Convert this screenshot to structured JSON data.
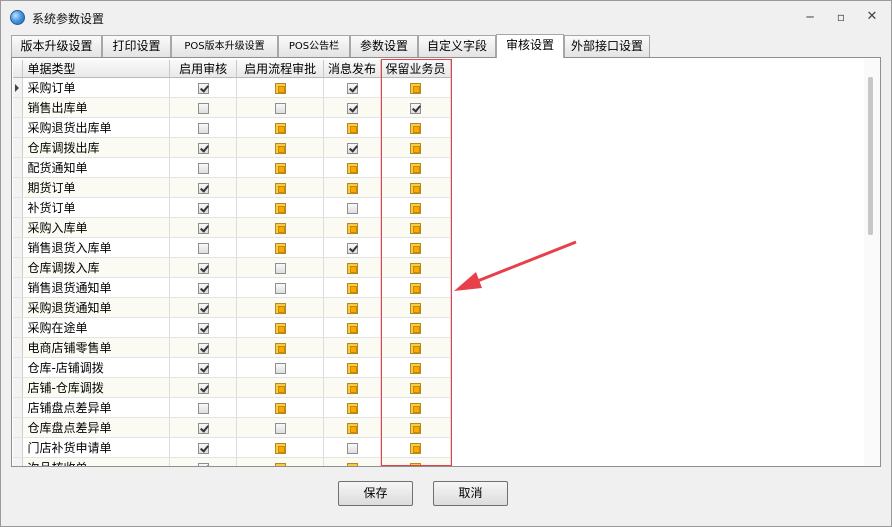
{
  "window": {
    "title": "系统参数设置",
    "minimize_label": "─",
    "maximize_label": "▫",
    "close_label": "✕"
  },
  "tabs": [
    {
      "label": "版本升级设置"
    },
    {
      "label": "打印设置"
    },
    {
      "label": "POS版本升级设置"
    },
    {
      "label": "POS公告栏"
    },
    {
      "label": "参数设置"
    },
    {
      "label": "自定义字段"
    },
    {
      "label": "审核设置"
    },
    {
      "label": "外部接口设置"
    }
  ],
  "active_tab": "审核设置",
  "grid": {
    "columns": [
      "单据类型",
      "启用审核",
      "启用流程审批",
      "消息发布",
      "保留业务员"
    ],
    "rows": [
      {
        "name": "采购订单",
        "review": "checked",
        "workflow": "indeterminate",
        "message": "checked",
        "salesman": "indeterminate"
      },
      {
        "name": "销售出库单",
        "review": "unchecked",
        "workflow": "unchecked",
        "message": "checked",
        "salesman": "checked"
      },
      {
        "name": "采购退货出库单",
        "review": "unchecked",
        "workflow": "indeterminate",
        "message": "indeterminate",
        "salesman": "indeterminate"
      },
      {
        "name": "仓库调拨出库",
        "review": "checked",
        "workflow": "indeterminate",
        "message": "checked",
        "salesman": "indeterminate"
      },
      {
        "name": "配货通知单",
        "review": "unchecked",
        "workflow": "indeterminate",
        "message": "indeterminate",
        "salesman": "indeterminate"
      },
      {
        "name": "期货订单",
        "review": "checked",
        "workflow": "indeterminate",
        "message": "indeterminate",
        "salesman": "indeterminate"
      },
      {
        "name": "补货订单",
        "review": "checked",
        "workflow": "indeterminate",
        "message": "unchecked",
        "salesman": "indeterminate"
      },
      {
        "name": "采购入库单",
        "review": "checked",
        "workflow": "indeterminate",
        "message": "indeterminate",
        "salesman": "indeterminate"
      },
      {
        "name": "销售退货入库单",
        "review": "unchecked",
        "workflow": "indeterminate",
        "message": "checked",
        "salesman": "indeterminate"
      },
      {
        "name": "仓库调拨入库",
        "review": "checked",
        "workflow": "unchecked",
        "message": "indeterminate",
        "salesman": "indeterminate"
      },
      {
        "name": "销售退货通知单",
        "review": "checked",
        "workflow": "unchecked",
        "message": "indeterminate",
        "salesman": "indeterminate"
      },
      {
        "name": "采购退货通知单",
        "review": "checked",
        "workflow": "indeterminate",
        "message": "indeterminate",
        "salesman": "indeterminate"
      },
      {
        "name": "采购在途单",
        "review": "checked",
        "workflow": "indeterminate",
        "message": "indeterminate",
        "salesman": "indeterminate"
      },
      {
        "name": "电商店铺零售单",
        "review": "checked",
        "workflow": "indeterminate",
        "message": "indeterminate",
        "salesman": "indeterminate"
      },
      {
        "name": "仓库-店铺调拨",
        "review": "checked",
        "workflow": "unchecked",
        "message": "indeterminate",
        "salesman": "indeterminate"
      },
      {
        "name": "店铺-仓库调拨",
        "review": "checked",
        "workflow": "indeterminate",
        "message": "indeterminate",
        "salesman": "indeterminate"
      },
      {
        "name": "店铺盘点差异单",
        "review": "unchecked",
        "workflow": "indeterminate",
        "message": "indeterminate",
        "salesman": "indeterminate"
      },
      {
        "name": "仓库盘点差异单",
        "review": "checked",
        "workflow": "unchecked",
        "message": "indeterminate",
        "salesman": "indeterminate"
      },
      {
        "name": "门店补货申请单",
        "review": "checked",
        "workflow": "indeterminate",
        "message": "unchecked",
        "salesman": "indeterminate"
      },
      {
        "name": "次品核收单",
        "review": "checked",
        "workflow": "indeterminate",
        "message": "indeterminate",
        "salesman": "indeterminate"
      }
    ]
  },
  "buttons": {
    "save": "保存",
    "cancel": "取消"
  },
  "colors": {
    "highlight_border": "#e8404a",
    "annotation_arrow": "#e8404a"
  },
  "icons": {
    "title_icon": "globe-icon",
    "row_indicator": "row-pointer-icon"
  }
}
